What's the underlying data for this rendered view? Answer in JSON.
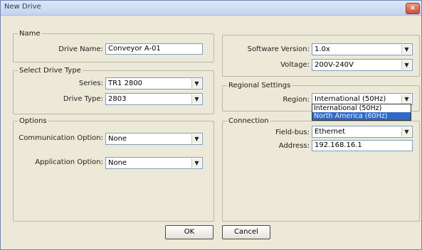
{
  "window": {
    "title": "New Drive",
    "close_label": "×"
  },
  "name_group": {
    "legend": "Name",
    "drive_name_label": "Drive Name:",
    "drive_name_value": "Conveyor A-01"
  },
  "drive_type_group": {
    "legend": "Select Drive Type",
    "series_label": "Series:",
    "series_value": "TR1 2800",
    "drive_type_label": "Drive Type:",
    "drive_type_value": "2803"
  },
  "version_group": {
    "software_version_label": "Software Version:",
    "software_version_value": "1.0x",
    "voltage_label": "Voltage:",
    "voltage_value": "200V-240V"
  },
  "regional_group": {
    "legend": "Regional Settings",
    "region_label": "Region:",
    "region_value": "International (50Hz)",
    "region_options": [
      "International (50Hz)",
      "North America (60Hz)"
    ]
  },
  "options_group": {
    "legend": "Options",
    "communication_label": "Communication Option:",
    "communication_value": "None",
    "application_label": "Application Option:",
    "application_value": "None"
  },
  "connection_group": {
    "legend": "Connection",
    "fieldbus_label": "Field-bus:",
    "fieldbus_value": "Ethernet",
    "address_label": "Address:",
    "address_value": "192.168.16.1"
  },
  "buttons": {
    "ok": "OK",
    "cancel": "Cancel"
  },
  "icons": {
    "combo_arrow": "▼"
  }
}
